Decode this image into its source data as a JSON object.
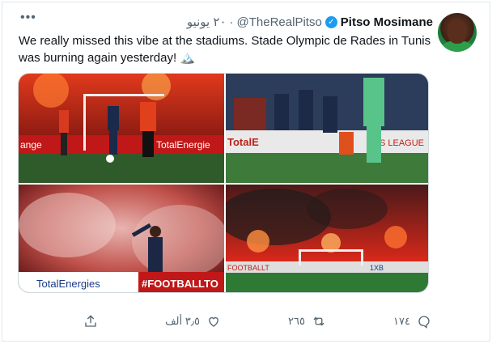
{
  "author": {
    "display_name": "Pitso Mosimane",
    "handle": "@TheRealPitso",
    "date": "٢٠ يونيو",
    "separator": "·"
  },
  "tweet": {
    "text": "We really missed this vibe at the stadiums. Stade Olympic de Rades in Tunis was burning again yesterday! 🏔️"
  },
  "media": {
    "photo1": {
      "ad_left": "ange",
      "ad_right": "TotalEnergie"
    },
    "photo2": {
      "ad_left": "TotalE",
      "ad_right": "S LEAGUE"
    },
    "photo3": {
      "ad_left": "TotalEnergies",
      "ad_right": "#FOOTBALLTO"
    },
    "photo4": {
      "ad_left": "FOOTBALLT",
      "ad_right": "1XB"
    }
  },
  "actions": {
    "replies": "١٧٤",
    "retweets": "٢٦٥",
    "likes": "٣٫٥ ألف"
  },
  "icons": {
    "more": "more-icon",
    "verified": "verified-badge-icon",
    "reply": "reply-icon",
    "retweet": "retweet-icon",
    "like": "heart-icon",
    "share": "share-icon"
  },
  "colors": {
    "accent": "#1d9bf0",
    "muted": "#536471",
    "flare_red": "#d9241a"
  }
}
